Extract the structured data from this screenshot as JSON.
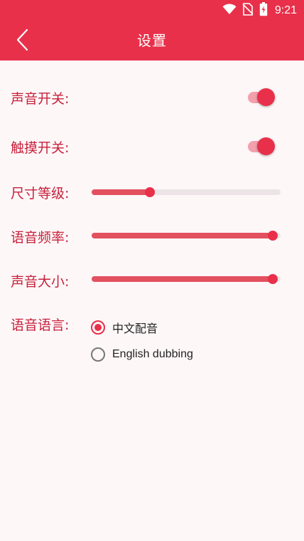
{
  "status_bar": {
    "time": "9:21",
    "icons": [
      "wifi-icon",
      "no-sim-icon",
      "battery-charging-icon"
    ]
  },
  "app_bar": {
    "title": "设置",
    "back_icon": "chevron-left-icon"
  },
  "colors": {
    "accent": "#e8304a",
    "label": "#c8213b",
    "background": "#fdf7f8"
  },
  "settings": {
    "sound_switch": {
      "label": "声音开关:",
      "on": true
    },
    "touch_switch": {
      "label": "触摸开关:",
      "on": true
    },
    "size_level": {
      "label": "尺寸等级:",
      "value_fraction": 0.31
    },
    "voice_rate": {
      "label": "语音频率:",
      "value_fraction": 0.96
    },
    "volume": {
      "label": "声音大小:",
      "value_fraction": 0.96
    },
    "voice_language": {
      "label": "语音语言:",
      "options": [
        {
          "label": "中文配音",
          "checked": true
        },
        {
          "label": "English dubbing",
          "checked": false
        }
      ]
    }
  }
}
